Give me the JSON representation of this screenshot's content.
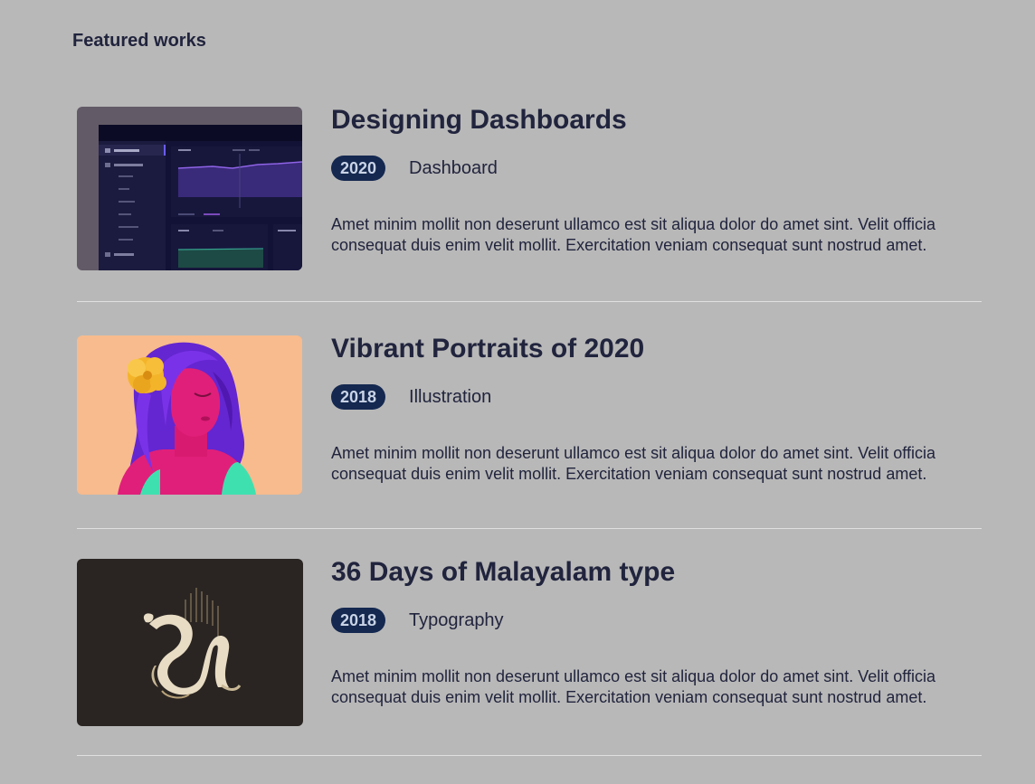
{
  "section": {
    "title": "Featured works"
  },
  "works": [
    {
      "title": "Designing Dashboards",
      "year": "2020",
      "category": "Dashboard",
      "description": "Amet minim mollit non deserunt ullamco est sit aliqua dolor do amet sint. Velit officia consequat duis enim velit mollit. Exercitation veniam consequat sunt nostrud amet.",
      "thumbnail_icon": "dashboard-screenshot-thumbnail"
    },
    {
      "title": "Vibrant Portraits of 2020",
      "year": "2018",
      "category": "Illustration",
      "description": "Amet minim mollit non deserunt ullamco est sit aliqua dolor do amet sint. Velit officia consequat duis enim velit mollit. Exercitation veniam consequat sunt nostrud amet.",
      "thumbnail_icon": "portrait-illustration-thumbnail"
    },
    {
      "title": "36 Days of Malayalam type",
      "year": "2018",
      "category": "Typography",
      "description": "Amet minim mollit non deserunt ullamco est sit aliqua dolor do amet sint. Velit officia consequat duis enim velit mollit. Exercitation veniam consequat sunt nostrud amet.",
      "thumbnail_icon": "malayalam-letter-thumbnail"
    }
  ],
  "colors": {
    "background": "#b8b8b8",
    "text": "#21243d",
    "badge_background": "#142850",
    "divider": "#e0e0e0"
  }
}
